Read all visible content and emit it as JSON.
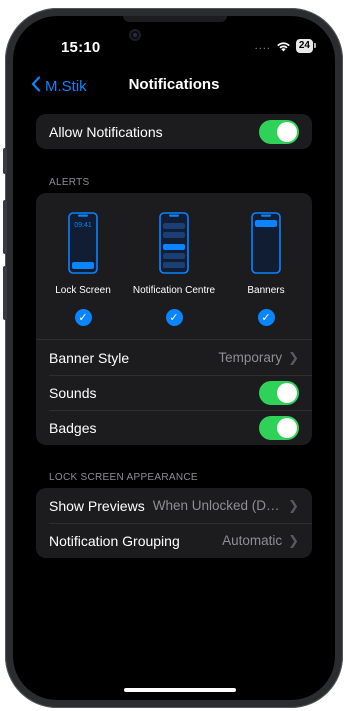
{
  "status": {
    "time": "15:10",
    "signal": "....",
    "wifi_icon": "wifi-icon",
    "battery": "24"
  },
  "nav": {
    "back_label": "M.Stik",
    "title": "Notifications"
  },
  "allow_notifications": {
    "label": "Allow Notifications",
    "on": true
  },
  "alerts": {
    "header": "ALERTS",
    "options": [
      {
        "label": "Lock Screen",
        "checked": true,
        "preview_time": "09:41"
      },
      {
        "label": "Notification Centre",
        "checked": true
      },
      {
        "label": "Banners",
        "checked": true
      }
    ],
    "banner_style": {
      "label": "Banner Style",
      "value": "Temporary"
    },
    "sounds": {
      "label": "Sounds",
      "on": true
    },
    "badges": {
      "label": "Badges",
      "on": true
    }
  },
  "lock_screen_appearance": {
    "header": "LOCK SCREEN APPEARANCE",
    "show_previews": {
      "label": "Show Previews",
      "value": "When Unlocked (Defa..."
    },
    "notification_grouping": {
      "label": "Notification Grouping",
      "value": "Automatic"
    }
  },
  "colors": {
    "accent": "#0a84ff",
    "toggle_on": "#30d158",
    "cell_bg": "#1c1c1e",
    "secondary_text": "#8e8e93"
  }
}
